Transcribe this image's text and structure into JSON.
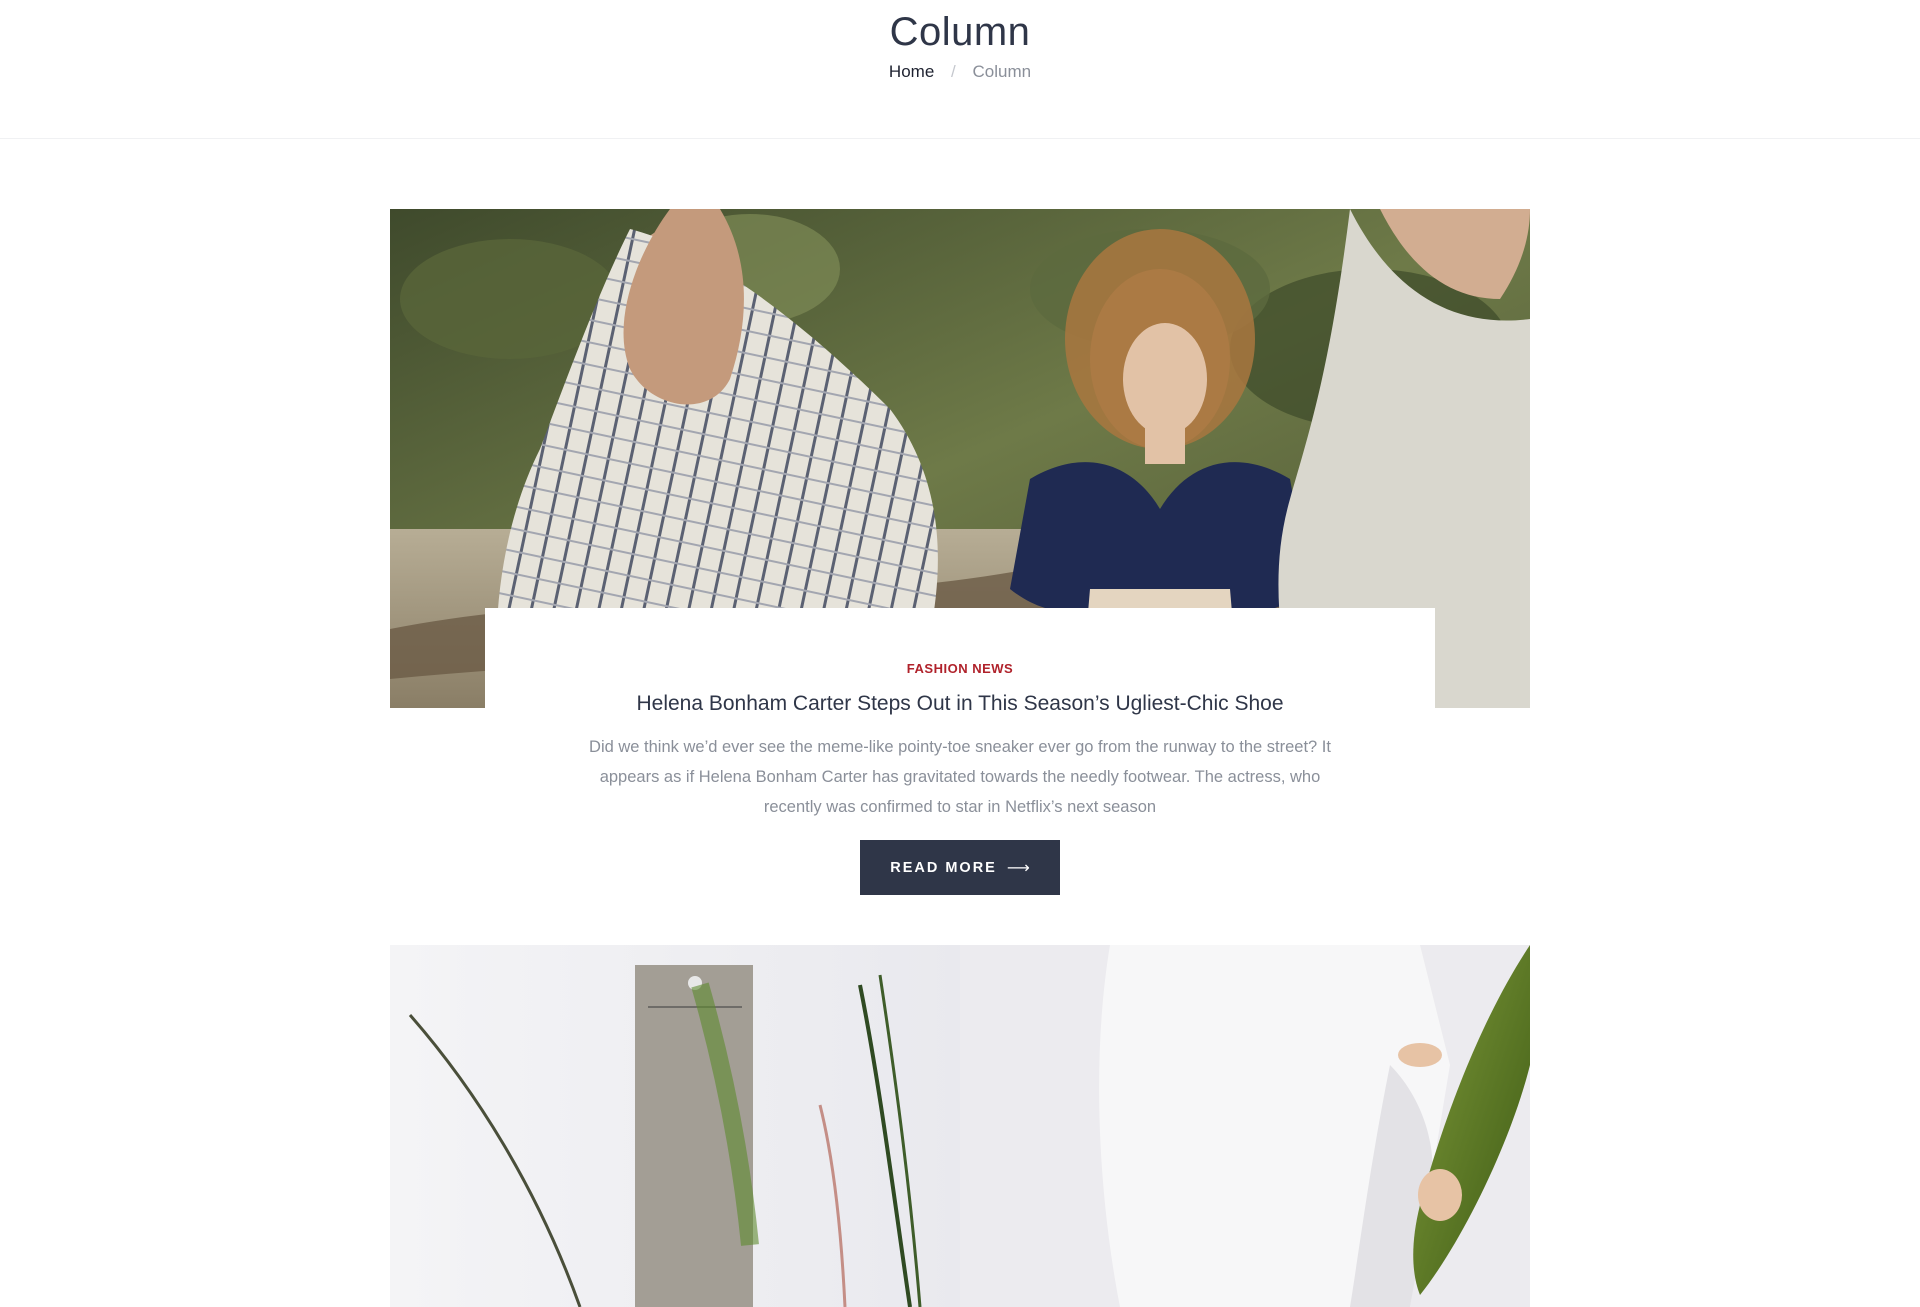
{
  "header": {
    "title": "Column",
    "breadcrumb": {
      "home": "Home",
      "current": "Column"
    }
  },
  "post": {
    "category": "FASHION NEWS",
    "title": "Helena Bonham Carter Steps Out in This Season’s Ugliest-Chic Shoe",
    "excerpt": "Did we think we’d ever see the meme-like pointy-toe sneaker ever go from the runway to the street? It appears as if Helena Bonham Carter has gravitated towards the needly footwear. The actress, who recently was confirmed to star in Netflix’s next season",
    "read_more_label": "READ MORE",
    "read_more_icon": "arrow-right-icon"
  },
  "colors": {
    "primary": "#2f3648",
    "accent": "#b0222b",
    "muted_text": "#8a8f99"
  }
}
